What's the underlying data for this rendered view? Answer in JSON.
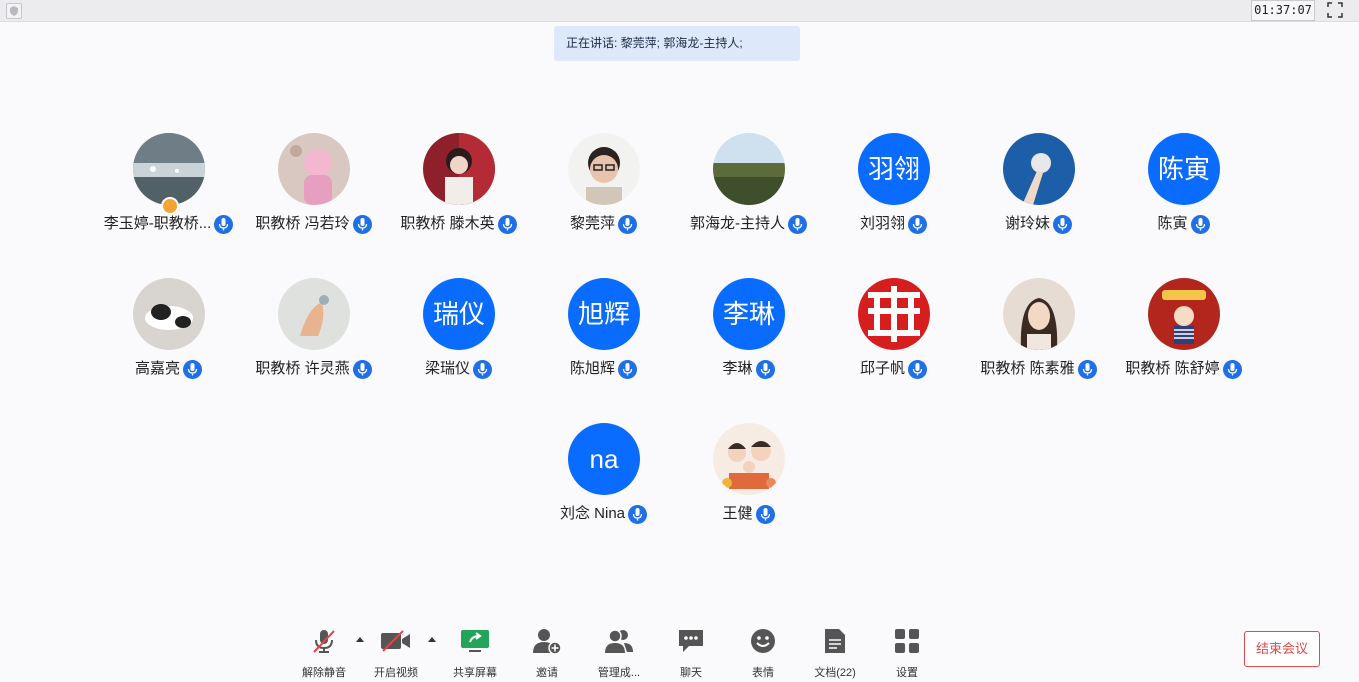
{
  "topbar": {
    "timer": "01:37:07"
  },
  "speaking_banner": "正在讲话: 黎莞萍; 郭海龙-主持人;",
  "participants": [
    {
      "name": "李玉婷-职教桥..."
    },
    {
      "name": "职教桥 冯若玲"
    },
    {
      "name": "职教桥 滕木英"
    },
    {
      "name": "黎莞萍"
    },
    {
      "name": "郭海龙-主持人"
    },
    {
      "name": "刘羽翎",
      "initials": "羽翎"
    },
    {
      "name": "谢玲妹"
    },
    {
      "name": "陈寅",
      "initials": "陈寅"
    },
    {
      "name": "高嘉亮"
    },
    {
      "name": "职教桥 许灵燕"
    },
    {
      "name": "梁瑞仪",
      "initials": "瑞仪"
    },
    {
      "name": "陈旭辉",
      "initials": "旭辉"
    },
    {
      "name": "李琳",
      "initials": "李琳"
    },
    {
      "name": "邱子帆"
    },
    {
      "name": "职教桥 陈素雅"
    },
    {
      "name": "职教桥 陈舒婷"
    },
    {
      "name": "刘念 Nina",
      "initials": "na"
    },
    {
      "name": "王健"
    }
  ],
  "toolbar": {
    "unmute": "解除静音",
    "start_video": "开启视频",
    "share_screen": "共享屏幕",
    "invite": "邀请",
    "manage_members": "管理成...",
    "chat": "聊天",
    "emoji": "表情",
    "documents": "文档(22)",
    "settings": "设置",
    "end_meeting": "结束会议"
  },
  "colors": {
    "accent": "#0a6cff",
    "danger": "#e04a4a",
    "banner": "#dde9fb"
  }
}
